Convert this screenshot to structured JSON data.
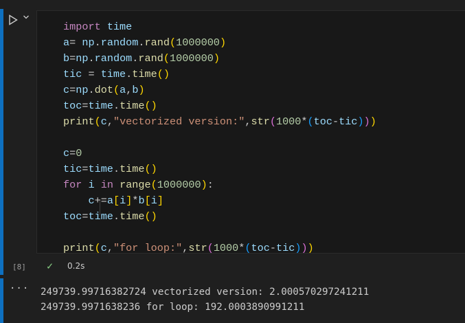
{
  "cell": {
    "run_icon": "play-icon",
    "chevron_icon": "chevron-down-icon",
    "exec_count": "[8]",
    "status_icon": "check-icon",
    "exec_time": "0.2s",
    "code_lines": [
      "import time",
      "a= np.random.rand(1000000)",
      "b=np.random.rand(1000000)",
      "tic = time.time()",
      "c=np.dot(a,b)",
      "toc=time.time()",
      "print(c,\"vectorized version:\",str(1000*(toc-tic)))",
      "",
      "c=0",
      "tic=time.time()",
      "for i in range(1000000):",
      "    c+=a[i]*b[i]",
      "toc=time.time()",
      "",
      "print(c,\"for loop:\",str(1000*(toc-tic)))"
    ]
  },
  "output": {
    "more_icon": "ellipsis-icon",
    "lines": [
      "249739.99716382724 vectorized version: 2.000570297241211",
      "249739.9971638236 for loop: 192.0003890991211"
    ]
  },
  "colors": {
    "accent": "#0e70c0",
    "keyword": "#c586c0",
    "function": "#dcdcaa",
    "variable": "#9cdcfe",
    "number": "#b5cea8",
    "string": "#ce9178",
    "success": "#89d185"
  }
}
